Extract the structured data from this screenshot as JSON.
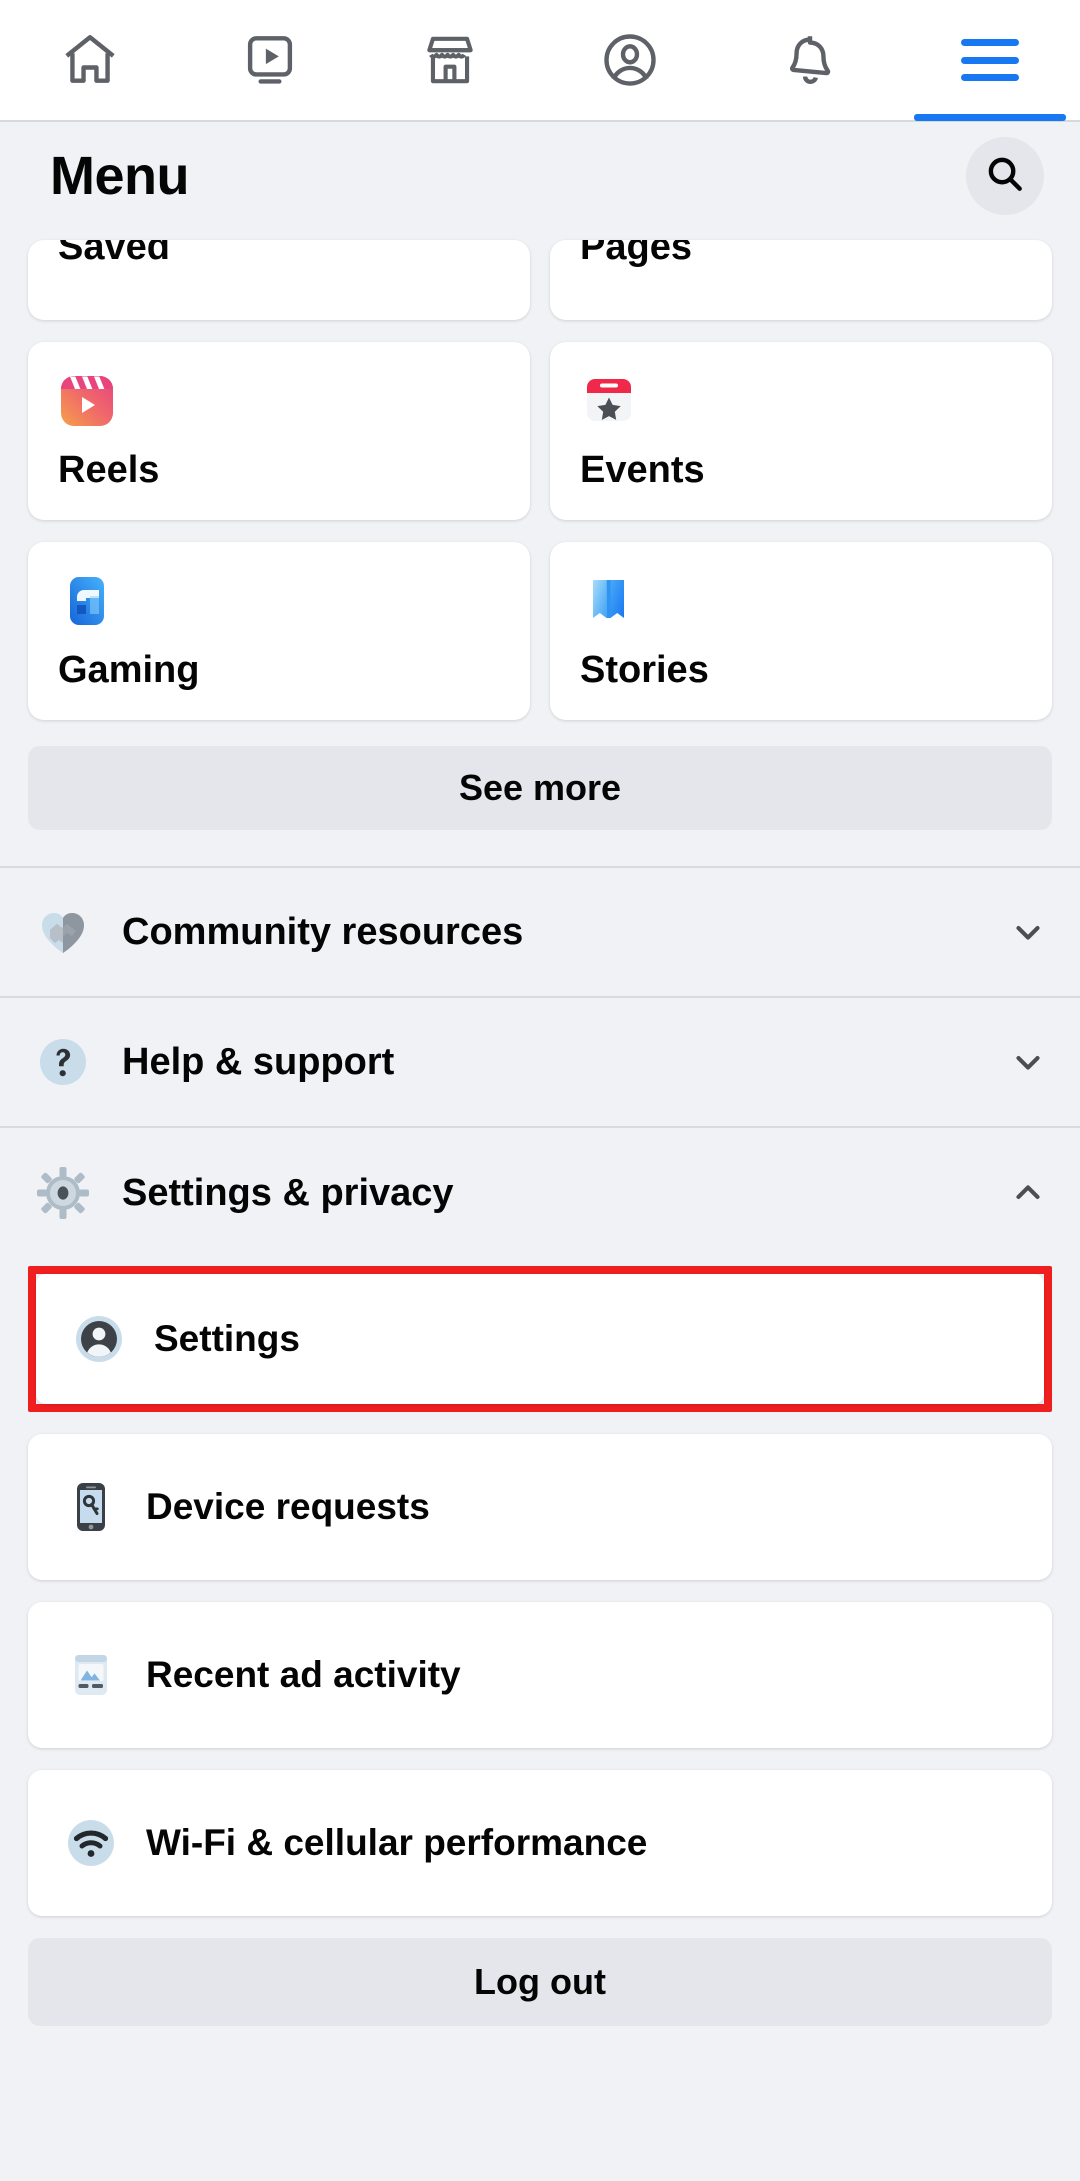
{
  "topnav": {
    "items": [
      {
        "name": "home-icon",
        "label": "Home",
        "active": false
      },
      {
        "name": "video-icon",
        "label": "Video",
        "active": false
      },
      {
        "name": "marketplace-icon",
        "label": "Marketplace",
        "active": false
      },
      {
        "name": "profile-icon",
        "label": "Profile",
        "active": false
      },
      {
        "name": "notifications-icon",
        "label": "Notifications",
        "active": false
      },
      {
        "name": "menu-icon",
        "label": "Menu",
        "active": true
      }
    ],
    "active_color": "#1877f2",
    "inactive_color": "#5e6167"
  },
  "header": {
    "title": "Menu",
    "search_icon": "search-icon"
  },
  "tiles": [
    {
      "label": "Saved",
      "icon": "saved-icon",
      "clipped": true
    },
    {
      "label": "Pages",
      "icon": "pages-icon",
      "clipped": true
    },
    {
      "label": "Reels",
      "icon": "reels-icon",
      "clipped": false
    },
    {
      "label": "Events",
      "icon": "events-icon",
      "clipped": false
    },
    {
      "label": "Gaming",
      "icon": "gaming-icon",
      "clipped": false
    },
    {
      "label": "Stories",
      "icon": "stories-icon",
      "clipped": false
    }
  ],
  "see_more": {
    "label": "See more"
  },
  "sections": [
    {
      "label": "Community resources",
      "icon": "handshake-heart-icon",
      "expanded": false,
      "chevron": "chevron-down-icon"
    },
    {
      "label": "Help & support",
      "icon": "question-mark-icon",
      "expanded": false,
      "chevron": "chevron-down-icon"
    },
    {
      "label": "Settings & privacy",
      "icon": "gear-icon",
      "expanded": true,
      "chevron": "chevron-up-icon"
    }
  ],
  "settings_items": [
    {
      "label": "Settings",
      "icon": "account-avatar-icon",
      "highlighted": true
    },
    {
      "label": "Device requests",
      "icon": "phone-key-icon",
      "highlighted": false
    },
    {
      "label": "Recent ad activity",
      "icon": "ad-card-icon",
      "highlighted": false
    },
    {
      "label": "Wi-Fi & cellular performance",
      "icon": "wifi-icon",
      "highlighted": false
    }
  ],
  "logout": {
    "label": "Log out"
  },
  "colors": {
    "page_bg": "#f0f2f5",
    "card_bg": "#ffffff",
    "accent_blue": "#1877f2",
    "highlight_red": "#f01f1f",
    "button_grey": "#e4e6eb",
    "text_primary": "#050505"
  }
}
